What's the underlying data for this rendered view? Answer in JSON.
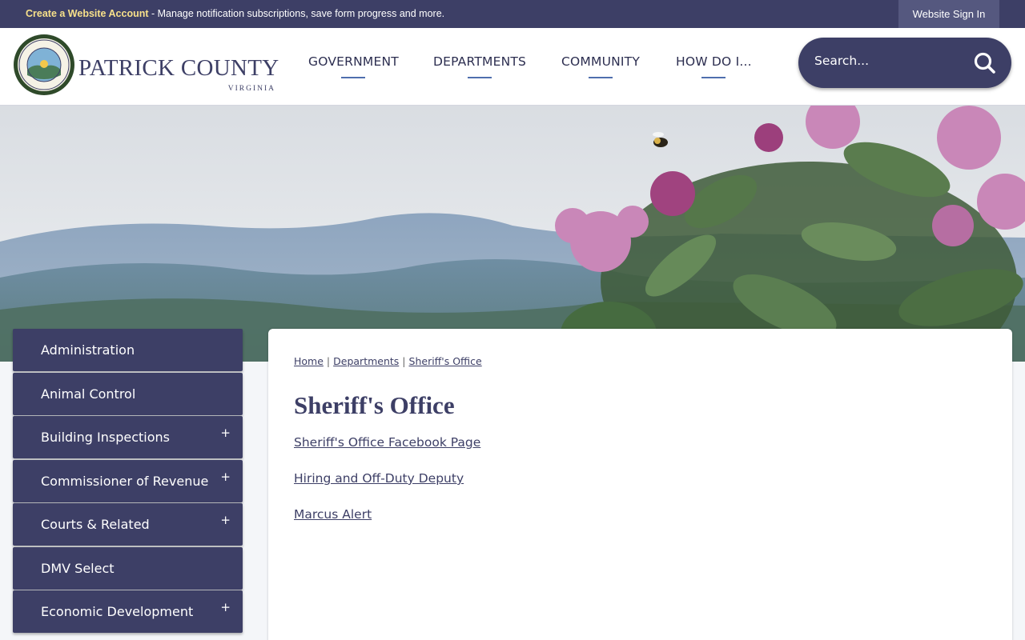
{
  "topbar": {
    "account_link": "Create a Website Account",
    "account_text": " - Manage notification subscriptions, save form progress and more.",
    "signin": "Website Sign In"
  },
  "logo": {
    "name": "PATRICK COUNTY",
    "sub": "VIRGINIA"
  },
  "nav": {
    "items": [
      {
        "label": "GOVERNMENT"
      },
      {
        "label": "DEPARTMENTS"
      },
      {
        "label": "COMMUNITY"
      },
      {
        "label": "HOW DO I..."
      }
    ]
  },
  "search": {
    "placeholder": "Search..."
  },
  "sidebar": {
    "items": [
      {
        "label": "Administration",
        "expandable": false
      },
      {
        "label": "Animal Control",
        "expandable": false
      },
      {
        "label": "Building Inspections",
        "expandable": true
      },
      {
        "label": "Commissioner of Revenue",
        "expandable": true
      },
      {
        "label": "Courts & Related",
        "expandable": true
      },
      {
        "label": "DMV Select",
        "expandable": false
      },
      {
        "label": "Economic Development",
        "expandable": true
      }
    ],
    "plus": "+"
  },
  "breadcrumb": {
    "home": "Home",
    "departments": "Departments",
    "current": "Sheriff's Office",
    "separator": "|"
  },
  "page": {
    "title": "Sheriff's Office",
    "links": [
      {
        "label": "Sheriff's Office Facebook Page"
      },
      {
        "label": "Hiring and Off-Duty Deputy"
      },
      {
        "label": "Marcus Alert"
      }
    ]
  },
  "colors": {
    "brand_navy": "#3d3f66",
    "account_link": "#f7e08a",
    "nav_underline": "#4f6fae"
  }
}
